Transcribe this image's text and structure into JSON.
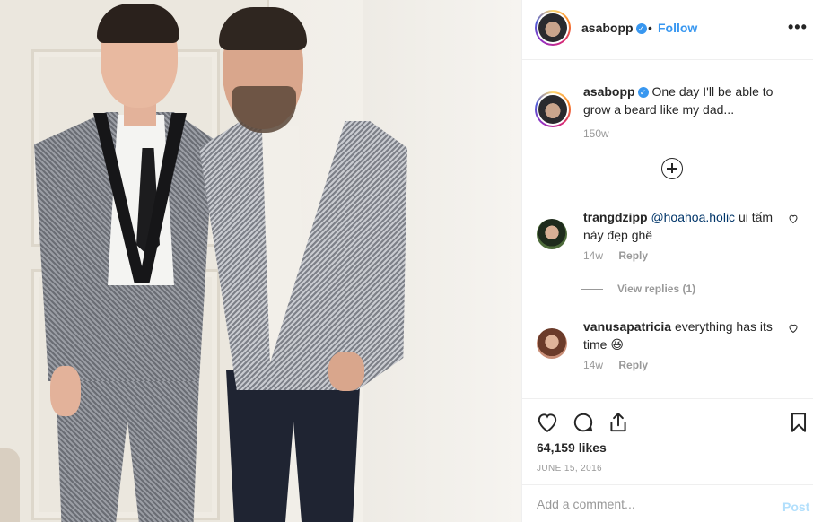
{
  "header": {
    "username": "asabopp",
    "separator": "•",
    "follow_label": "Follow",
    "more_icon": "more-options-icon",
    "more_label": "•••"
  },
  "caption": {
    "username": "asabopp",
    "text": "One day I'll be able to grow a beard like my dad...",
    "age": "150w"
  },
  "load_more_icon": "plus-circle-icon",
  "comments": [
    {
      "username": "trangdzipp",
      "mention": "@hoahoa.holic",
      "text": "ui tấm này đẹp ghê",
      "age": "14w",
      "reply_label": "Reply",
      "view_replies_label": "View replies (1)"
    },
    {
      "username": "vanusapatricia",
      "text": "everything has its time 😆",
      "age": "14w",
      "reply_label": "Reply"
    }
  ],
  "actions": {
    "icons": [
      "heart-icon",
      "comment-icon",
      "share-icon",
      "bookmark-icon"
    ],
    "likes": "64,159 likes",
    "date": "JUNE 15, 2016"
  },
  "add_comment": {
    "placeholder": "Add a comment...",
    "post_label": "Post"
  },
  "colors": {
    "link_blue": "#3897f0",
    "verified_blue": "#3897f0",
    "muted_gray": "#999999",
    "text": "#262626",
    "post_disabled": "#b2dffc"
  }
}
